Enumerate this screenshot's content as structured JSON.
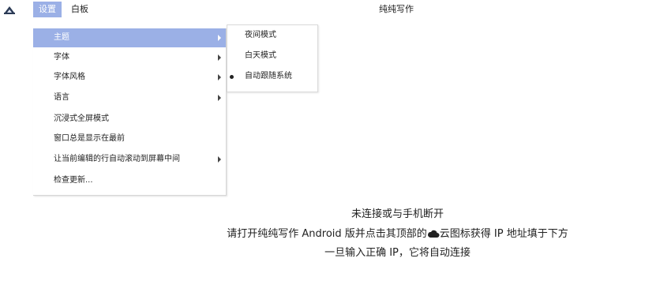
{
  "menubar": {
    "settings_label": "设置",
    "board_label": "白板",
    "window_title": "纯纯写作"
  },
  "dropdown": {
    "items": [
      {
        "label": "主题",
        "has_submenu": true,
        "active": true
      },
      {
        "label": "字体",
        "has_submenu": true
      },
      {
        "label": "字体风格",
        "has_submenu": true
      },
      {
        "label": "语言",
        "has_submenu": true
      },
      {
        "label": "沉浸式全屏模式",
        "has_submenu": false
      },
      {
        "label": "窗口总是显示在最前",
        "has_submenu": false
      },
      {
        "label": "让当前编辑的行自动滚动到屏幕中间",
        "has_submenu": true
      },
      {
        "label": "检查更新...",
        "has_submenu": false
      }
    ]
  },
  "submenu": {
    "items": [
      {
        "label": "夜间模式",
        "selected": false
      },
      {
        "label": "白天模式",
        "selected": false
      },
      {
        "label": "自动跟随系统",
        "selected": true
      }
    ]
  },
  "status": {
    "line1": "未连接或与手机断开",
    "line2_before": "请打开纯纯写作 Android 版并点击其顶部的",
    "line2_after": "云图标获得 IP 地址填于下方",
    "line3": "一旦输入正确 IP，它将自动连接"
  },
  "colors": {
    "menu_highlight": "#9bb0e6"
  },
  "icons": {
    "app": "app-logo-icon",
    "cloud": "cloud-icon",
    "submenu_arrow": "chevron-right-icon",
    "radio": "radio-dot-icon"
  }
}
